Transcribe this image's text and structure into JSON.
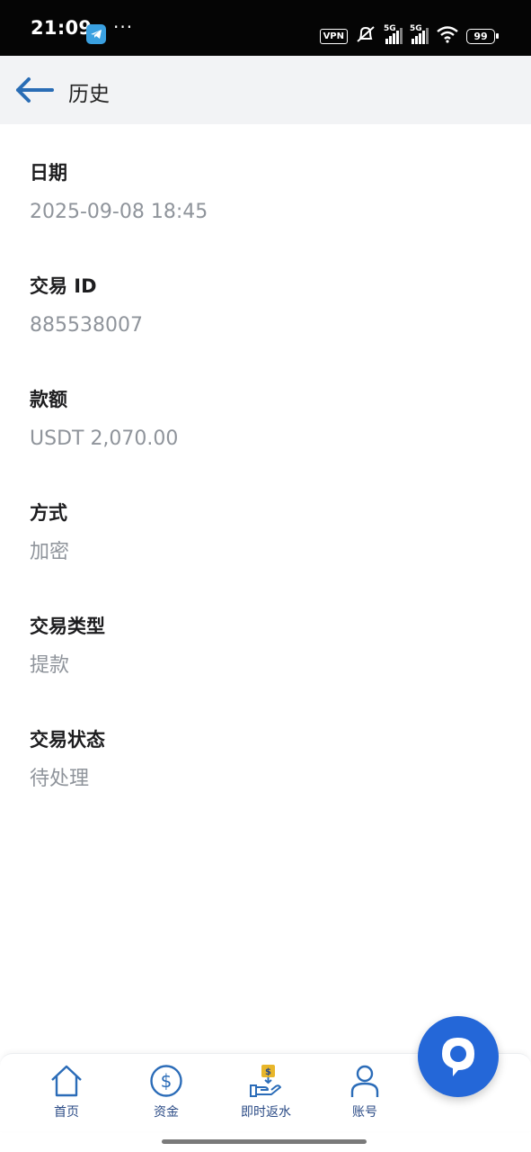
{
  "status_bar": {
    "time": "21:09",
    "dots": "···",
    "vpn": "VPN",
    "signal1": "5G",
    "signal2": "5G",
    "battery": "99"
  },
  "header": {
    "title": "历史"
  },
  "details": [
    {
      "label": "日期",
      "value": "2025-09-08 18:45"
    },
    {
      "label": "交易 ID",
      "value": "885538007"
    },
    {
      "label": "款额",
      "value": "USDT 2,070.00"
    },
    {
      "label": "方式",
      "value": "加密"
    },
    {
      "label": "交易类型",
      "value": "提款"
    },
    {
      "label": "交易状态",
      "value": "待处理"
    }
  ],
  "bottom_nav": [
    {
      "label": "首页",
      "icon": "home-icon"
    },
    {
      "label": "资金",
      "icon": "dollar-circle-icon"
    },
    {
      "label": "即时返水",
      "icon": "cashback-hand-icon"
    },
    {
      "label": "账号",
      "icon": "user-icon"
    }
  ],
  "colors": {
    "accent": "#2467d8",
    "nav_text": "#2b4b86",
    "value_text": "#8f949b",
    "header_bg": "#f2f3f5"
  }
}
